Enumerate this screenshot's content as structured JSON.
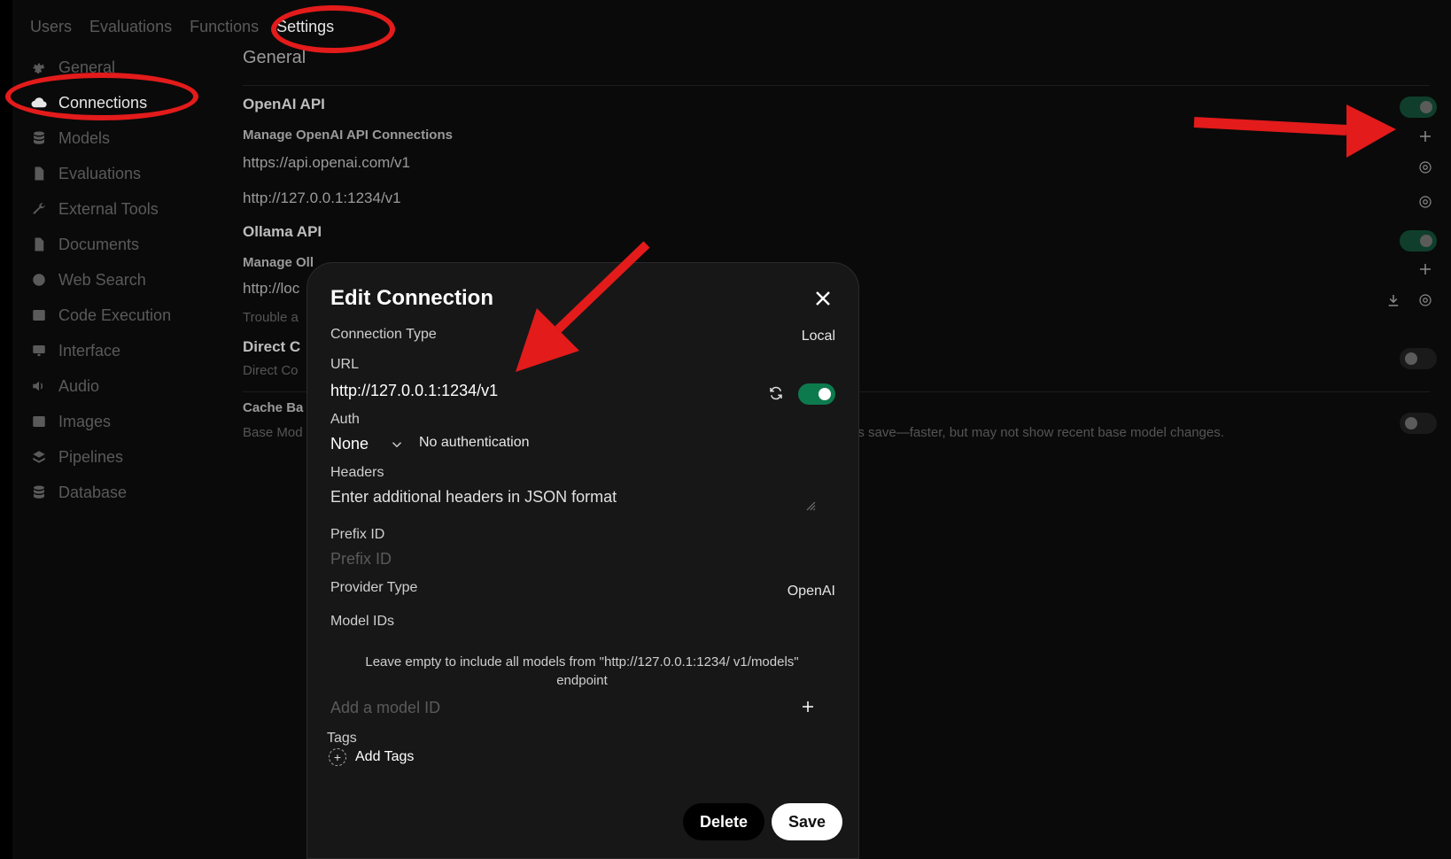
{
  "topnav": [
    "Users",
    "Evaluations",
    "Functions",
    "Settings"
  ],
  "sidebar": [
    {
      "label": "General",
      "icon": "gear-icon"
    },
    {
      "label": "Connections",
      "icon": "cloud-icon"
    },
    {
      "label": "Models",
      "icon": "database-icon"
    },
    {
      "label": "Evaluations",
      "icon": "document-icon"
    },
    {
      "label": "External Tools",
      "icon": "wrench-icon"
    },
    {
      "label": "Documents",
      "icon": "document-icon"
    },
    {
      "label": "Web Search",
      "icon": "globe-icon"
    },
    {
      "label": "Code Execution",
      "icon": "terminal-icon"
    },
    {
      "label": "Interface",
      "icon": "monitor-icon"
    },
    {
      "label": "Audio",
      "icon": "speaker-icon"
    },
    {
      "label": "Images",
      "icon": "image-icon"
    },
    {
      "label": "Pipelines",
      "icon": "layers-icon"
    },
    {
      "label": "Database",
      "icon": "database-icon"
    }
  ],
  "main": {
    "title": "General",
    "openai_title": "OpenAI API",
    "openai_manage": "Manage OpenAI API Connections",
    "openai_url1": "https://api.openai.com/v1",
    "openai_url2": "http://127.0.0.1:1234/v1",
    "ollama_title": "Ollama API",
    "ollama_manage": "Manage Oll",
    "ollama_url": "http://loc",
    "trouble": "Trouble a",
    "direct_title": "Direct C",
    "direct_desc": "Direct Co",
    "cache_title": "Cache Ba",
    "cache_desc": "Base Mod",
    "cache_desc_tail": "gs save—faster, but may not show recent base model changes."
  },
  "modal": {
    "title": "Edit Connection",
    "connection_type_label": "Connection Type",
    "connection_type_value": "Local",
    "url_label": "URL",
    "url_value": "http://127.0.0.1:1234/v1",
    "auth_label": "Auth",
    "auth_value": "None",
    "auth_desc": "No authentication",
    "headers_label": "Headers",
    "headers_placeholder": "Enter additional headers in JSON format",
    "prefix_label": "Prefix ID",
    "prefix_placeholder": "Prefix ID",
    "provider_label": "Provider Type",
    "provider_value": "OpenAI",
    "model_ids_label": "Model IDs",
    "model_ids_help": "Leave empty to include all models from \"http://127.0.0.1:1234/ v1/models\" endpoint",
    "add_model_placeholder": "Add a model ID",
    "tags_label": "Tags",
    "add_tags": "Add Tags",
    "delete_label": "Delete",
    "save_label": "Save"
  },
  "colors": {
    "accent_green": "#0d7a4d",
    "annotation_red": "#e31b1b"
  }
}
